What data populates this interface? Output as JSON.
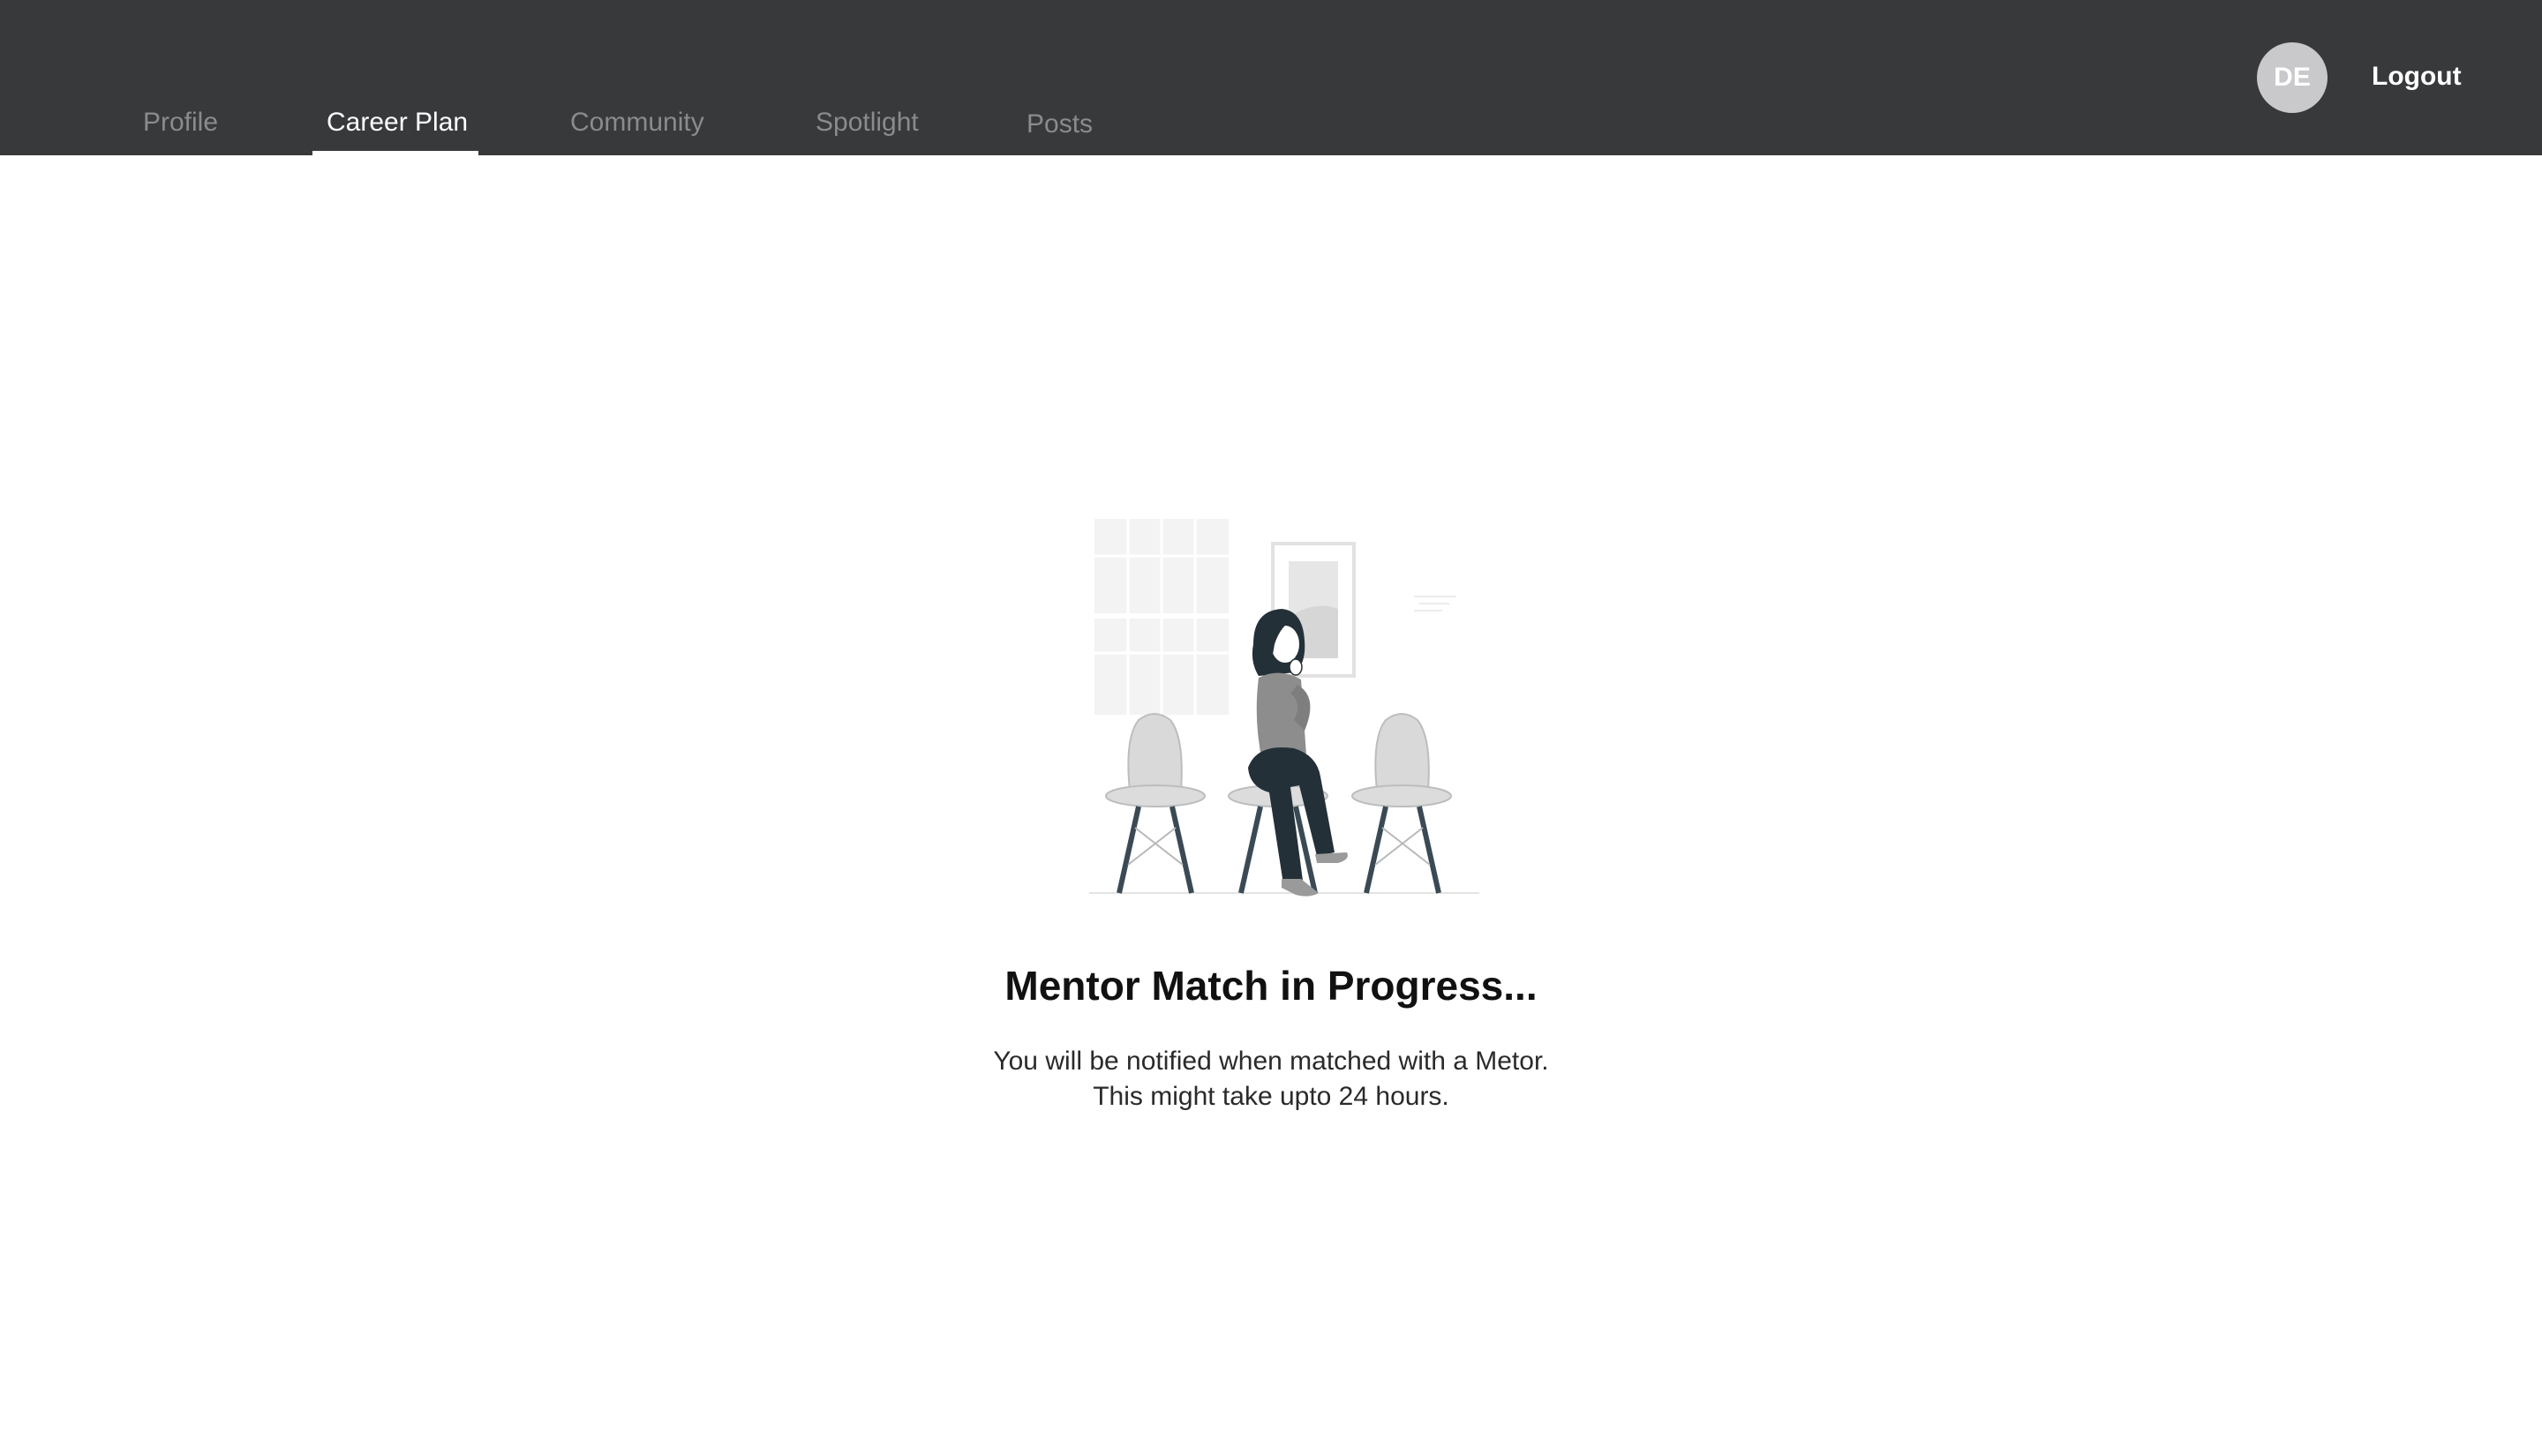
{
  "nav": {
    "items": [
      {
        "label": "Profile"
      },
      {
        "label": "Career Plan"
      },
      {
        "label": "Community"
      },
      {
        "label": "Spotlight"
      },
      {
        "label": "Posts"
      }
    ],
    "active_index": 1
  },
  "user": {
    "initials": "DE",
    "logout_label": "Logout"
  },
  "status": {
    "illustration": "waiting-room-illustration",
    "title": "Mentor Match in Progress...",
    "line1": "You will be notified when matched with a Metor.",
    "line2": "This might take upto 24 hours."
  },
  "colors": {
    "topbar_bg": "#38393b",
    "nav_inactive": "#8a8b8d",
    "nav_active": "#ffffff",
    "avatar_bg": "#c9c9cb"
  }
}
